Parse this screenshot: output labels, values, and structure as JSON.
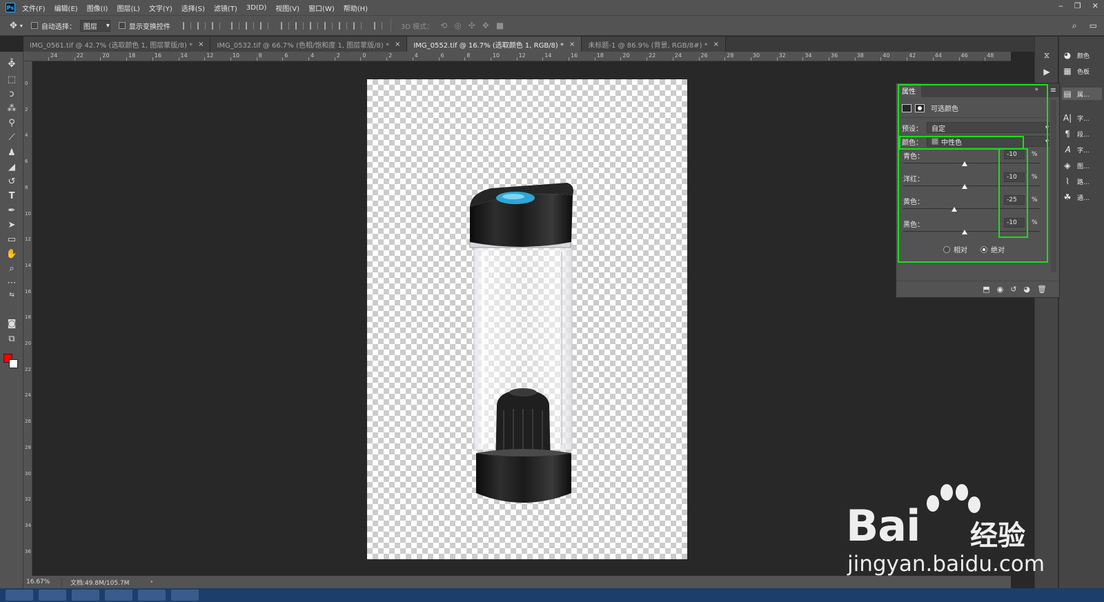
{
  "menubar": {
    "logo": "Ps",
    "items": [
      "文件(F)",
      "编辑(E)",
      "图像(I)",
      "图层(L)",
      "文字(Y)",
      "选择(S)",
      "滤镜(T)",
      "3D(D)",
      "视图(V)",
      "窗口(W)",
      "帮助(H)"
    ],
    "window_controls": [
      "‒",
      "❐",
      "✕"
    ]
  },
  "options": {
    "auto_select_label": "自动选择：",
    "auto_select_value": "图层",
    "transform_label": "显示变换控件",
    "mode_3d_label": "3D 模式："
  },
  "tabs": [
    {
      "label": "IMG_0561.tif @ 42.7% (选取颜色 1, 图层蒙版/8) *",
      "close": "×"
    },
    {
      "label": "IMG_0532.tif @ 66.7% (色相/饱和度 1, 图层蒙版/8) *",
      "close": "×"
    },
    {
      "label": "IMG_0552.tif @ 16.7% (选取颜色 1, RGB/8) *",
      "close": "×"
    },
    {
      "label": "未标题-1 @ 86.9% (背景, RGB/8#) *",
      "close": "×"
    }
  ],
  "ruler_top": [
    "24",
    "22",
    "20",
    "18",
    "16",
    "14",
    "12",
    "10",
    "8",
    "6",
    "4",
    "2",
    "0",
    "2",
    "4",
    "6",
    "8",
    "10",
    "12",
    "14",
    "16",
    "18",
    "20",
    "22",
    "24",
    "26",
    "28",
    "30",
    "32",
    "34",
    "36",
    "38",
    "40",
    "42",
    "44",
    "46",
    "48"
  ],
  "ruler_left": [
    "0",
    "2",
    "4",
    "6",
    "8",
    "10",
    "12",
    "14",
    "16",
    "18",
    "20",
    "22",
    "24",
    "26",
    "28",
    "30",
    "32",
    "34",
    "36"
  ],
  "status": {
    "zoom": "16.67%",
    "doc_info": "文档:49.8M/105.7M",
    "arrow": "›"
  },
  "properties": {
    "tab": "属性",
    "collapse": "»",
    "menu": "≡",
    "adjustment_name": "可选颜色",
    "preset_label": "预设：",
    "preset_value": "自定",
    "color_label": "颜色：",
    "color_value": "中性色",
    "sliders": [
      {
        "label": "青色：",
        "value": "-10",
        "unit": "%"
      },
      {
        "label": "洋红：",
        "value": "-10",
        "unit": "%"
      },
      {
        "label": "黄色：",
        "value": "-25",
        "unit": "%"
      },
      {
        "label": "黑色：",
        "value": "-10",
        "unit": "%"
      }
    ],
    "slider_levels": [
      -10,
      -10,
      -25,
      -10
    ],
    "method_relative": "相对",
    "method_absolute": "绝对"
  },
  "right_panels": [
    {
      "icon": "palette-icon",
      "glyph": "◕",
      "label": "颜色"
    },
    {
      "icon": "swatches-icon",
      "glyph": "▦",
      "label": "色板"
    },
    {
      "icon": "properties-icon",
      "glyph": "▤",
      "label": "属..."
    },
    {
      "icon": "character-icon",
      "glyph": "A|",
      "label": "字..."
    },
    {
      "icon": "paragraph-icon",
      "glyph": "¶",
      "label": "段..."
    },
    {
      "icon": "glyphs-icon",
      "glyph": "𝐴",
      "label": "字..."
    },
    {
      "icon": "layers-icon",
      "glyph": "◈",
      "label": "图..."
    },
    {
      "icon": "paths-icon",
      "glyph": "⌇",
      "label": "路..."
    },
    {
      "icon": "channels-icon",
      "glyph": "☘",
      "label": "通..."
    }
  ],
  "watermark": {
    "main": "Bai",
    "cn": "经验",
    "url": "jingyan.baidu.com"
  },
  "colors": {
    "foreground": "#ff0000",
    "background": "#ffffff",
    "highlight": "#18e018",
    "bottle_cap_accent": "#2ea6d6"
  }
}
